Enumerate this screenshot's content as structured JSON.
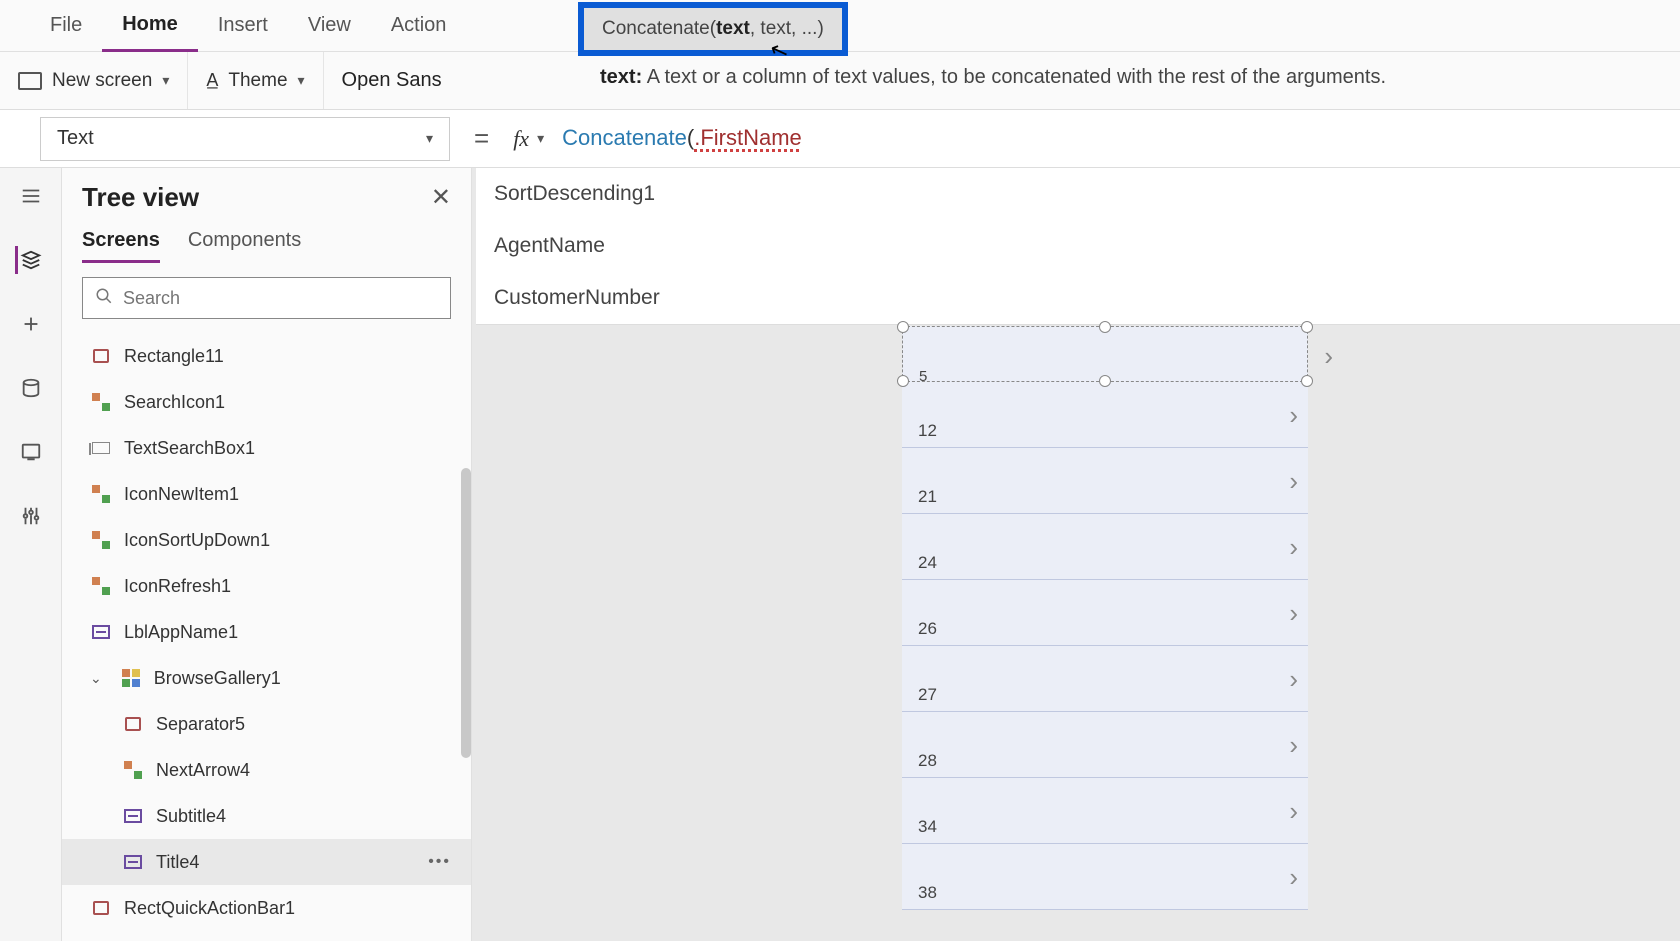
{
  "menu": {
    "file": "File",
    "home": "Home",
    "insert": "Insert",
    "view": "View",
    "action": "Action"
  },
  "tooltip": {
    "fn": "Concatenate(",
    "arg_bold": "text",
    "rest": ", text, ...)"
  },
  "ribbon": {
    "new_screen": "New screen",
    "theme": "Theme",
    "font": "Open Sans"
  },
  "help": {
    "label": "text:",
    "desc": " A text or a column of text values, to be concatenated with the rest of the arguments."
  },
  "property": "Text",
  "formula": {
    "fn": "Concatenate",
    "open": "(",
    "member": ".FirstName"
  },
  "suggestions": [
    "SortDescending1",
    "AgentName",
    "CustomerNumber"
  ],
  "tree": {
    "title": "Tree view",
    "tabs": {
      "screens": "Screens",
      "components": "Components"
    },
    "search_placeholder": "Search",
    "items": [
      {
        "label": "Rectangle11",
        "icon": "rect"
      },
      {
        "label": "SearchIcon1",
        "icon": "multi"
      },
      {
        "label": "TextSearchBox1",
        "icon": "text"
      },
      {
        "label": "IconNewItem1",
        "icon": "multi"
      },
      {
        "label": "IconSortUpDown1",
        "icon": "multi"
      },
      {
        "label": "IconRefresh1",
        "icon": "multi"
      },
      {
        "label": "LblAppName1",
        "icon": "label"
      },
      {
        "label": "BrowseGallery1",
        "icon": "gallery",
        "expandable": true
      },
      {
        "label": "Separator5",
        "icon": "rect",
        "nested": true
      },
      {
        "label": "NextArrow4",
        "icon": "multi",
        "nested": true
      },
      {
        "label": "Subtitle4",
        "icon": "label",
        "nested": true
      },
      {
        "label": "Title4",
        "icon": "label",
        "nested": true,
        "selected": true
      },
      {
        "label": "RectQuickActionBar1",
        "icon": "rect"
      }
    ]
  },
  "gallery": {
    "selected_num": "5",
    "rows": [
      "12",
      "21",
      "24",
      "26",
      "27",
      "28",
      "34",
      "38"
    ]
  }
}
